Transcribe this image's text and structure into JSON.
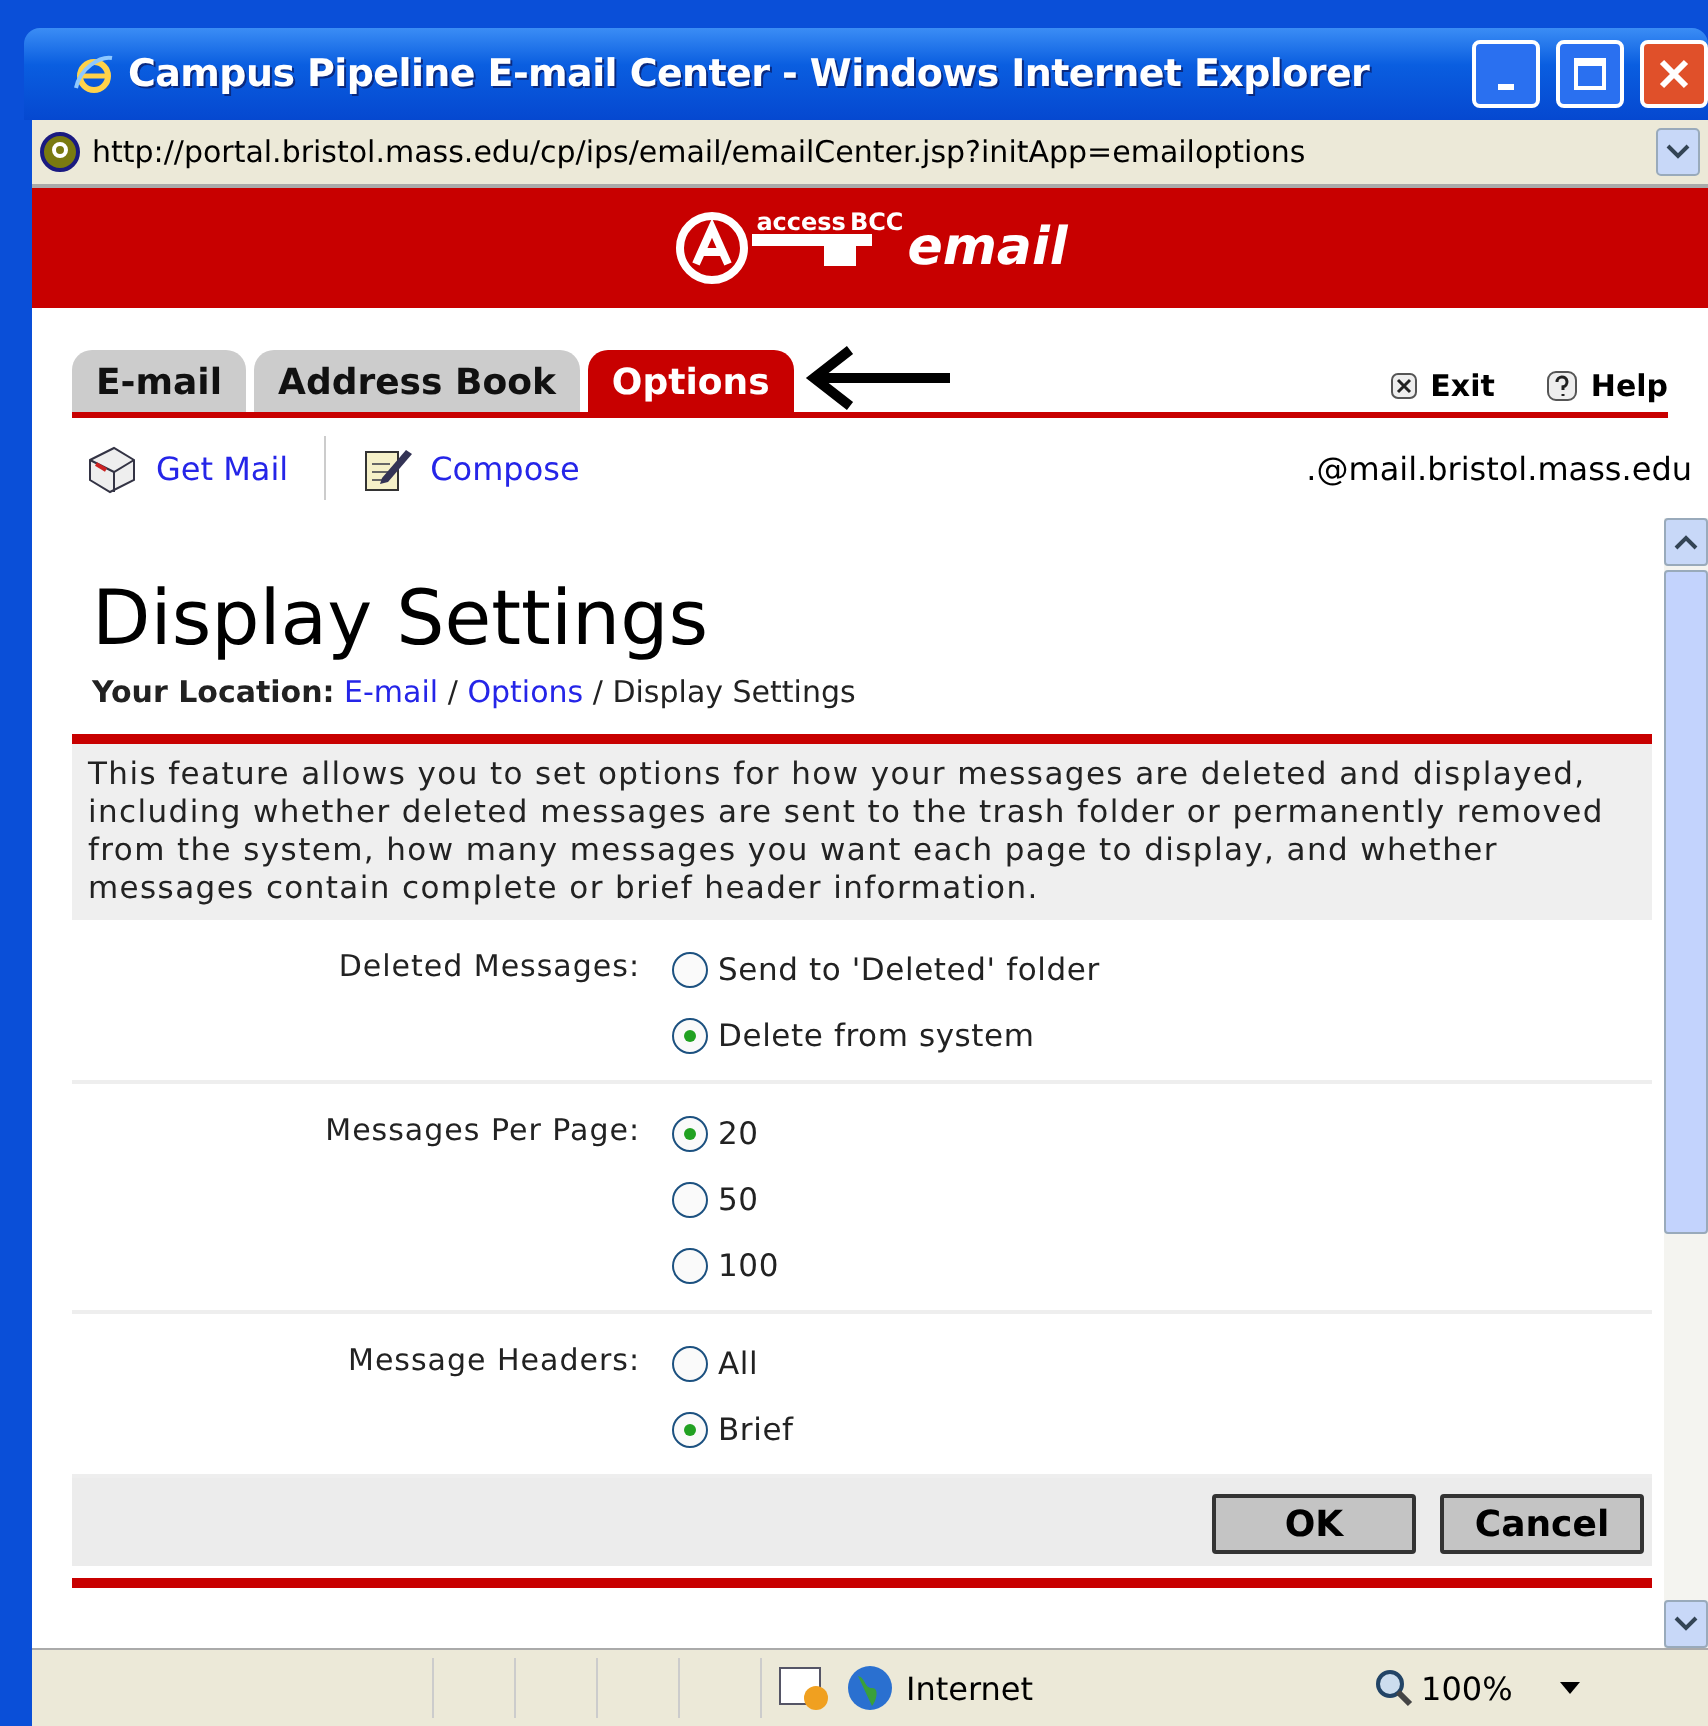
{
  "window": {
    "title": "Campus Pipeline E-mail Center - Windows Internet Explorer"
  },
  "address_bar": {
    "url": "http://portal.bristol.mass.edu/cp/ips/email/emailCenter.jsp?initApp=emailoptions"
  },
  "logo": {
    "prefix": "access",
    "brand": "BCC",
    "word": "email"
  },
  "tabs": [
    {
      "label": "E-mail",
      "selected": false
    },
    {
      "label": "Address Book",
      "selected": false
    },
    {
      "label": "Options",
      "selected": true
    }
  ],
  "top_links": [
    {
      "label": "Exit",
      "kind": "exit"
    },
    {
      "label": "Help",
      "kind": "help"
    }
  ],
  "toolbar": [
    {
      "label": "Get Mail",
      "kind": "mail"
    },
    {
      "label": "Compose",
      "kind": "compose"
    }
  ],
  "account": ".@mail.bristol.mass.edu",
  "heading": "Display Settings",
  "breadcrumb": {
    "label": "Your Location:",
    "links": [
      {
        "label": "E-mail",
        "separator": "/"
      },
      {
        "label": "Options",
        "separator": "/"
      }
    ],
    "current": "Display Settings"
  },
  "description": "This feature allows you to set options for how your messages are deleted and displayed, including whether deleted messages are sent to the trash folder or permanently removed from the system, how many messages you want each page to display, and whether messages contain complete or brief header information.",
  "settings": [
    {
      "label": "Deleted Messages:",
      "options": [
        {
          "label": "Send to 'Deleted' folder",
          "selected": false
        },
        {
          "label": "Delete from system",
          "selected": true
        }
      ]
    },
    {
      "label": "Messages Per Page:",
      "options": [
        {
          "label": "20",
          "selected": true
        },
        {
          "label": "50",
          "selected": false
        },
        {
          "label": "100",
          "selected": false
        }
      ]
    },
    {
      "label": "Message Headers:",
      "options": [
        {
          "label": "All",
          "selected": false
        },
        {
          "label": "Brief",
          "selected": true
        }
      ]
    }
  ],
  "buttons": [
    "OK",
    "Cancel"
  ],
  "status_bar": {
    "zone": "Internet",
    "zoom": "100%"
  }
}
